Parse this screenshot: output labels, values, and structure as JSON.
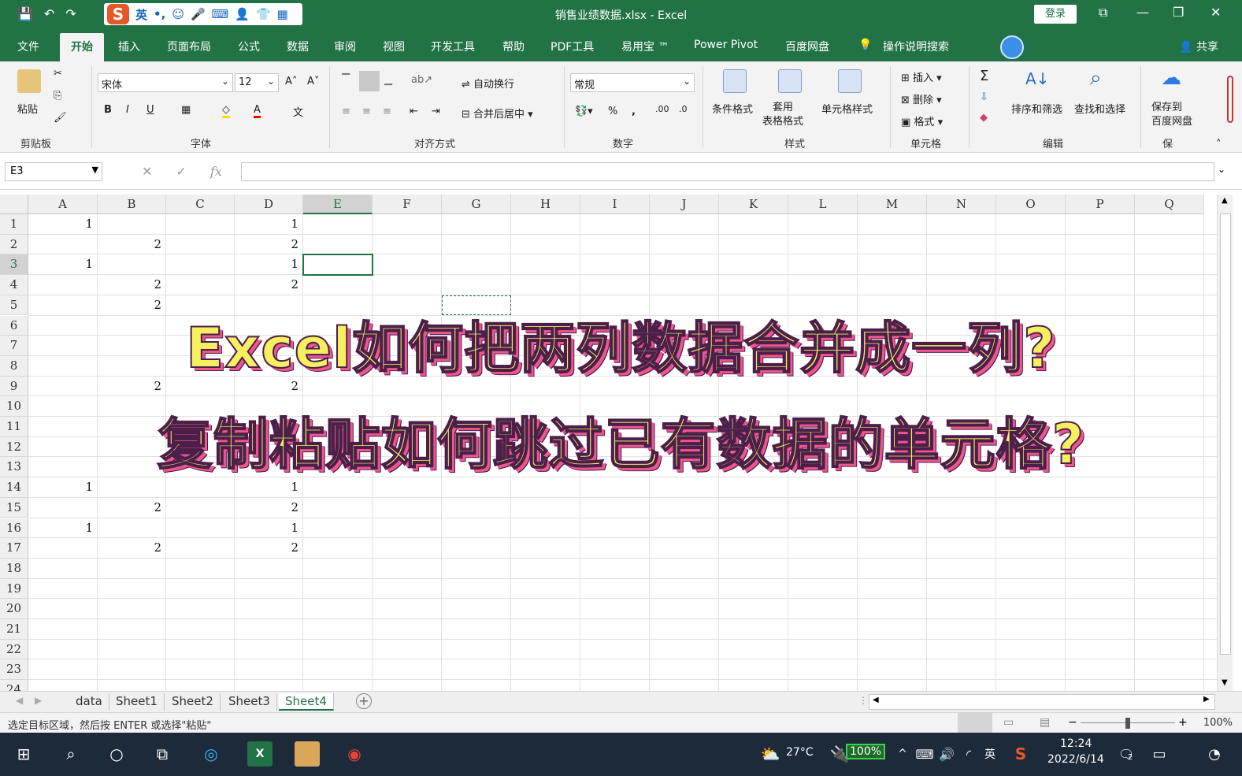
{
  "titlebar": {
    "title": "销售业绩数据.xlsx  -  Excel",
    "login": "登录",
    "ime_lang": "英"
  },
  "menu": {
    "tabs": [
      "文件",
      "开始",
      "插入",
      "页面布局",
      "公式",
      "数据",
      "审阅",
      "视图",
      "开发工具",
      "帮助",
      "PDF工具",
      "易用宝 ™",
      "Power Pivot",
      "百度网盘",
      "操作说明搜索"
    ],
    "active": "开始",
    "share": "共享"
  },
  "ribbon": {
    "paste": "粘贴",
    "font_name": "宋体",
    "font_size": "12",
    "wrap_text": "自动换行",
    "merge_center": "合并后居中",
    "number_format": "常规",
    "conditional_format": "条件格式",
    "table_format": "套用\n表格格式",
    "cell_styles": "单元格样式",
    "insert": "插入",
    "delete": "删除",
    "format": "格式",
    "sort_filter": "排序和筛选",
    "find_select": "查找和选择",
    "save_to": "保存到\n百度网盘",
    "group_labels": {
      "clipboard": "剪贴板",
      "font": "字体",
      "alignment": "对齐方式",
      "number": "数字",
      "styles": "样式",
      "cells": "单元格",
      "editing": "编辑",
      "save": "保"
    }
  },
  "formula_bar": {
    "name_box": "E3",
    "fx": "fx",
    "value": ""
  },
  "grid": {
    "columns": [
      "A",
      "B",
      "C",
      "D",
      "E",
      "F",
      "G",
      "H",
      "I",
      "J",
      "K",
      "L",
      "M",
      "N",
      "O",
      "P",
      "Q"
    ],
    "rows": [
      "1",
      "2",
      "3",
      "4",
      "5",
      "6",
      "7",
      "8",
      "9",
      "10",
      "11",
      "12",
      "13",
      "14",
      "15",
      "16",
      "17",
      "18",
      "19",
      "20",
      "21",
      "22",
      "23",
      "24"
    ],
    "active_cell": "E3",
    "cells": [
      {
        "r": 1,
        "c": "A",
        "v": "1"
      },
      {
        "r": 1,
        "c": "D",
        "v": "1"
      },
      {
        "r": 2,
        "c": "B",
        "v": "2"
      },
      {
        "r": 2,
        "c": "D",
        "v": "2"
      },
      {
        "r": 3,
        "c": "A",
        "v": "1"
      },
      {
        "r": 3,
        "c": "D",
        "v": "1"
      },
      {
        "r": 4,
        "c": "B",
        "v": "2"
      },
      {
        "r": 4,
        "c": "D",
        "v": "2"
      },
      {
        "r": 5,
        "c": "B",
        "v": "2"
      },
      {
        "r": 9,
        "c": "B",
        "v": "2"
      },
      {
        "r": 9,
        "c": "D",
        "v": "2"
      },
      {
        "r": 14,
        "c": "A",
        "v": "1"
      },
      {
        "r": 14,
        "c": "D",
        "v": "1"
      },
      {
        "r": 15,
        "c": "B",
        "v": "2"
      },
      {
        "r": 15,
        "c": "D",
        "v": "2"
      },
      {
        "r": 16,
        "c": "A",
        "v": "1"
      },
      {
        "r": 16,
        "c": "D",
        "v": "1"
      },
      {
        "r": 17,
        "c": "B",
        "v": "2"
      },
      {
        "r": 17,
        "c": "D",
        "v": "2"
      }
    ]
  },
  "overlay": {
    "line1": "Excel如何把两列数据合并成一列?",
    "line2": "复制粘贴如何跳过已有数据的单元格?"
  },
  "sheets": {
    "tabs": [
      "data",
      "Sheet1",
      "Sheet2",
      "Sheet3",
      "Sheet4"
    ],
    "active": "Sheet4"
  },
  "status": {
    "message": "选定目标区域，然后按 ENTER 或选择\"粘贴\"",
    "zoom": "100%"
  },
  "taskbar": {
    "weather": "27°C",
    "battery": "100%",
    "ime": "英",
    "time": "12:24",
    "date": "2022/6/14",
    "notifications": "2"
  },
  "colors": {
    "excel_green": "#217346",
    "overlay_fill": "#f6ef5e",
    "overlay_shadow": "#f0568e",
    "overlay_stroke": "#4b1f4a"
  }
}
